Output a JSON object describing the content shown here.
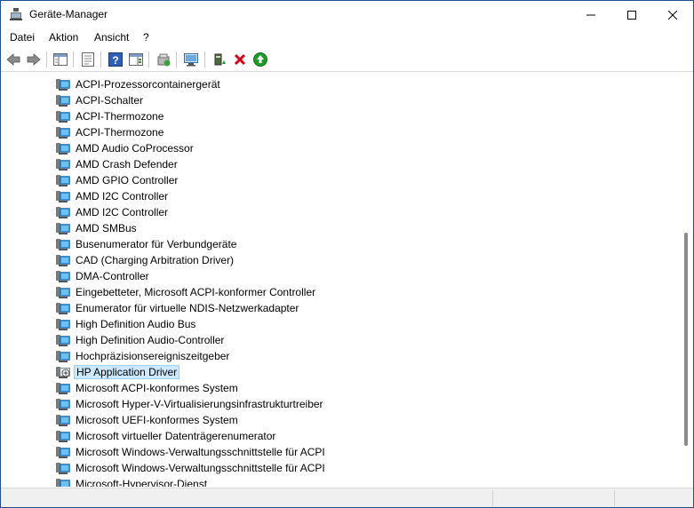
{
  "window": {
    "title": "Geräte-Manager",
    "icon": "device-manager-icon",
    "controls": [
      "minimize-icon",
      "maximize-icon",
      "close-icon"
    ]
  },
  "menu": {
    "items": [
      {
        "label": "Datei"
      },
      {
        "label": "Aktion"
      },
      {
        "label": "Ansicht"
      },
      {
        "label": "?"
      }
    ]
  },
  "toolbar": {
    "buttons": [
      "back-icon",
      "forward-icon",
      "show-hide-console-tree-icon",
      "properties-icon",
      "help-icon",
      "action-pane-icon",
      "update-driver-icon",
      "scan-hardware-icon",
      "enable-device-icon",
      "uninstall-device-icon",
      "enable-green-icon"
    ]
  },
  "devices": [
    {
      "label": "ACPI-Prozessorcontainergerät"
    },
    {
      "label": "ACPI-Schalter"
    },
    {
      "label": "ACPI-Thermozone"
    },
    {
      "label": "ACPI-Thermozone"
    },
    {
      "label": "AMD Audio CoProcessor"
    },
    {
      "label": "AMD Crash Defender"
    },
    {
      "label": "AMD GPIO Controller"
    },
    {
      "label": "AMD I2C Controller"
    },
    {
      "label": "AMD I2C Controller"
    },
    {
      "label": "AMD SMBus"
    },
    {
      "label": "Busenumerator für Verbundgeräte"
    },
    {
      "label": "CAD (Charging Arbitration Driver)"
    },
    {
      "label": "DMA-Controller"
    },
    {
      "label": "Eingebetteter, Microsoft ACPI-konformer Controller"
    },
    {
      "label": "Enumerator für virtuelle NDIS-Netzwerkadapter"
    },
    {
      "label": "High Definition Audio Bus"
    },
    {
      "label": "High Definition Audio-Controller"
    },
    {
      "label": "Hochpräzisionsereigniszeitgeber"
    },
    {
      "label": "HP Application Driver",
      "selected": true,
      "warning": true
    },
    {
      "label": "Microsoft ACPI-konformes System"
    },
    {
      "label": "Microsoft Hyper-V-Virtualisierungsinfrastrukturtreiber"
    },
    {
      "label": "Microsoft UEFI-konformes System"
    },
    {
      "label": "Microsoft virtueller Datenträgerenumerator"
    },
    {
      "label": "Microsoft Windows-Verwaltungsschnittstelle für ACPI"
    },
    {
      "label": "Microsoft Windows-Verwaltungsschnittstelle für ACPI"
    },
    {
      "label": "Microsoft-Hypervisor-Dienst"
    }
  ],
  "colors": {
    "selection_bg": "#cce8ff",
    "selection_border": "#99d1ff",
    "delete_red": "#d0021b",
    "enable_green": "#1e9a2b",
    "help_blue": "#2f5fb3"
  }
}
